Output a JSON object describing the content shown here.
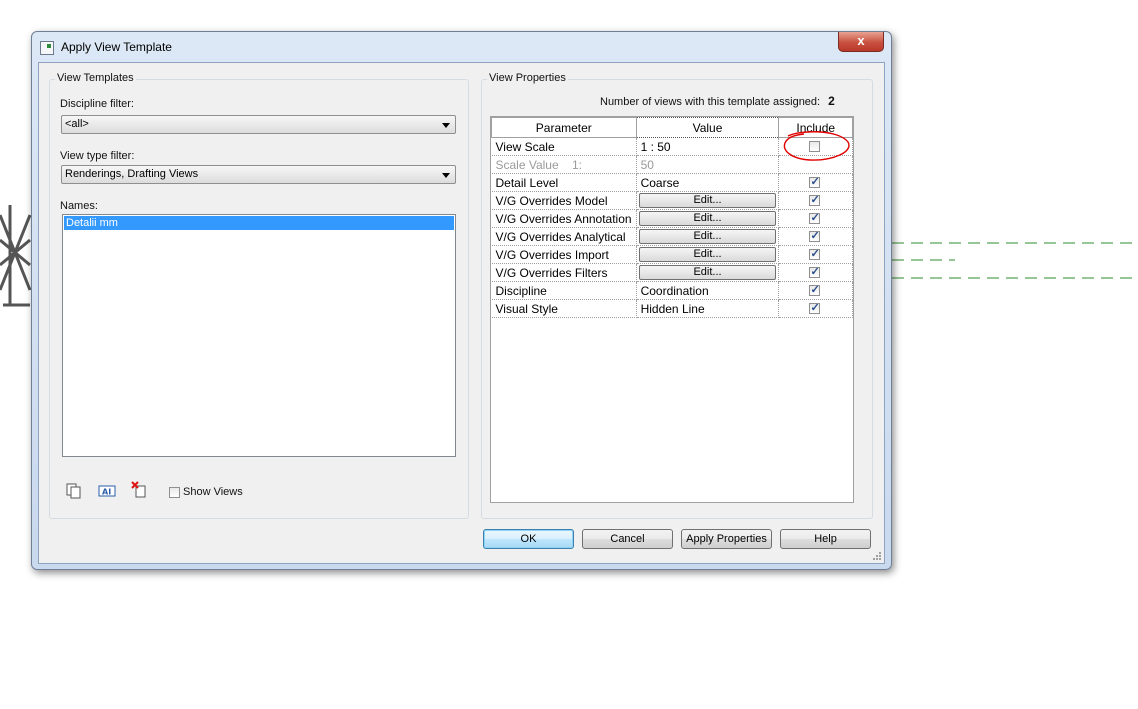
{
  "dialog": {
    "title": "Apply View Template",
    "close_label": "x"
  },
  "left_panel": {
    "legend": "View Templates",
    "discipline_label": "Discipline filter:",
    "discipline_value": "<all>",
    "view_type_label": "View type filter:",
    "view_type_value": "Renderings, Drafting Views",
    "names_label": "Names:",
    "names": [
      "Detalii mm"
    ],
    "show_views_label": "Show Views",
    "show_views_checked": false
  },
  "right_panel": {
    "legend": "View Properties",
    "count_label": "Number of views with this template assigned:",
    "count_value": "2",
    "columns": [
      "Parameter",
      "Value",
      "Include"
    ],
    "rows": [
      {
        "param": "View Scale",
        "value": "1 : 50",
        "type": "text",
        "include": false,
        "disabled": false
      },
      {
        "param": "Scale Value    1:",
        "value": "50",
        "type": "text",
        "include": null,
        "disabled": true
      },
      {
        "param": "Detail Level",
        "value": "Coarse",
        "type": "text",
        "include": true,
        "disabled": false
      },
      {
        "param": "V/G Overrides Model",
        "value": "Edit...",
        "type": "button",
        "include": true,
        "disabled": false
      },
      {
        "param": "V/G Overrides Annotation",
        "value": "Edit...",
        "type": "button",
        "include": true,
        "disabled": false
      },
      {
        "param": "V/G Overrides Analytical",
        "value": "Edit...",
        "type": "button",
        "include": true,
        "disabled": false
      },
      {
        "param": "V/G Overrides Import",
        "value": "Edit...",
        "type": "button",
        "include": true,
        "disabled": false
      },
      {
        "param": "V/G Overrides Filters",
        "value": "Edit...",
        "type": "button",
        "include": true,
        "disabled": false
      },
      {
        "param": "Discipline",
        "value": "Coordination",
        "type": "text",
        "include": true,
        "disabled": false
      },
      {
        "param": "Visual Style",
        "value": "Hidden Line",
        "type": "text",
        "include": true,
        "disabled": false
      }
    ]
  },
  "buttons": {
    "ok": "OK",
    "cancel": "Cancel",
    "apply": "Apply Properties",
    "help": "Help"
  },
  "colors": {
    "selection": "#3399ff",
    "annotation": "#e00000",
    "dashed_lines": "#2e8b2e"
  }
}
